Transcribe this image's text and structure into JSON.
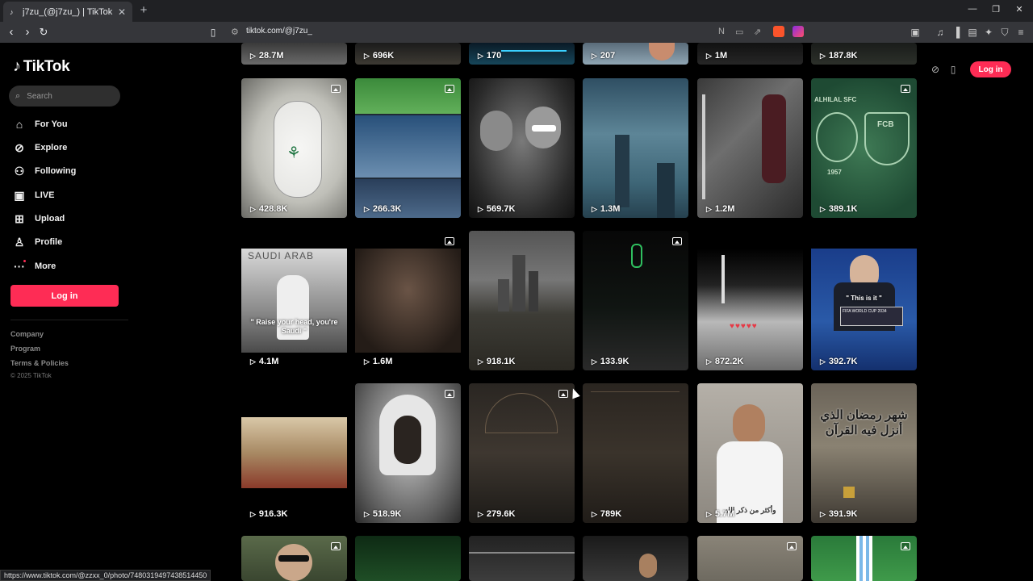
{
  "browser": {
    "tab_title": "j7zu_(@j7zu_) | TikTok",
    "url": "tiktok.com/@j7zu_",
    "status_url": "https://www.tiktok.com/@zzxx_0/photo/7480319497438514450"
  },
  "sidebar": {
    "brand": "TikTok",
    "search_placeholder": "Search",
    "items": [
      {
        "label": "For You",
        "icon": "home-icon"
      },
      {
        "label": "Explore",
        "icon": "compass-icon"
      },
      {
        "label": "Following",
        "icon": "following-icon"
      },
      {
        "label": "LIVE",
        "icon": "live-icon"
      },
      {
        "label": "Upload",
        "icon": "upload-icon"
      },
      {
        "label": "Profile",
        "icon": "profile-icon"
      },
      {
        "label": "More",
        "icon": "more-icon"
      }
    ],
    "login_label": "Log in",
    "footer": [
      "Company",
      "Program",
      "Terms & Policies"
    ],
    "copyright": "© 2025 TikTok"
  },
  "header": {
    "login_label": "Log in"
  },
  "grid": {
    "row0": [
      "28.7M",
      "696K",
      "170",
      "207",
      "1M",
      "187.8K"
    ],
    "row1": [
      "428.8K",
      "266.3K",
      "569.7K",
      "1.3M",
      "1.2M",
      "389.1K"
    ],
    "row2": [
      "4.1M",
      "1.6M",
      "918.1K",
      "133.9K",
      "872.2K",
      "392.7K"
    ],
    "row3": [
      "916.3K",
      "518.9K",
      "279.6K",
      "789K",
      "5.7M",
      "391.9K"
    ]
  },
  "captions": {
    "saudi_header": "SAUDI ARAB",
    "raise_head": "\" Raise your head, you're Saudi \"",
    "this_is_it": "\" This is it \"",
    "fifa": "FIFA WORLD CUP 2034",
    "alhilal": "ALHILAL SFC",
    "fcb": "FCB",
    "year": "1957",
    "ramadan": "شهر رمضان الذي أنزل فيه القرآن",
    "dhikr": "وأكثر من ذكر الله"
  },
  "colors": {
    "accent": "#fe2c55",
    "background": "#000000",
    "sidebar_text": "#f1f1f1"
  }
}
